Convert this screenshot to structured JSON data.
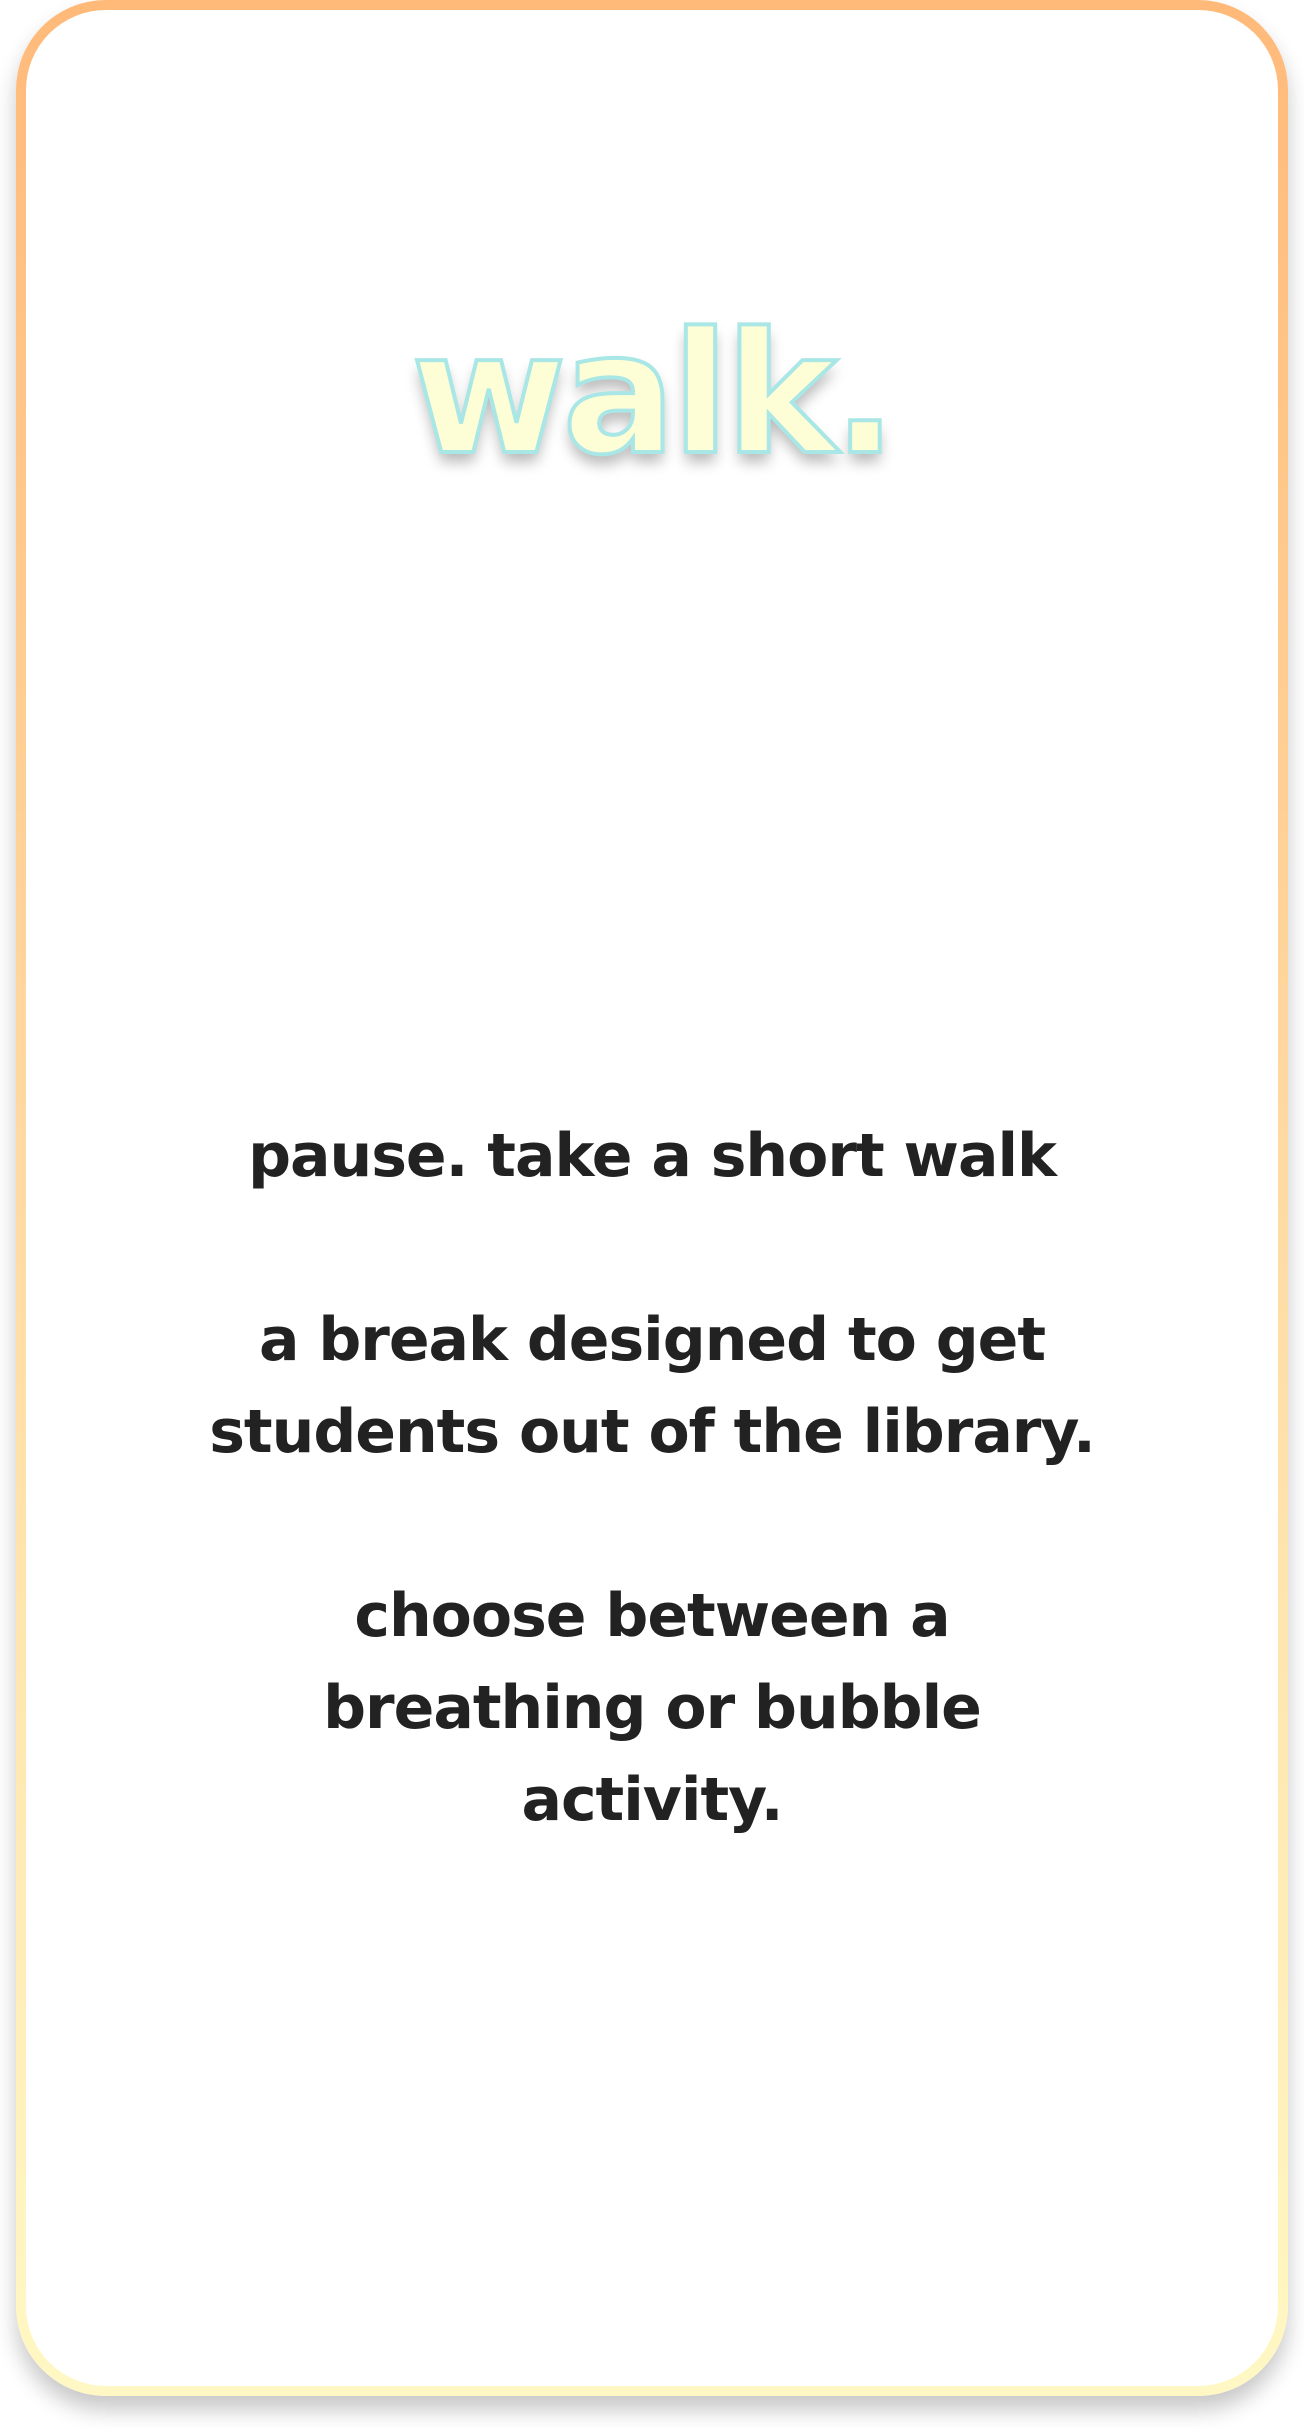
{
  "card": {
    "logo_text": "walk.",
    "tagline": "pause. take a short walk",
    "description": "a break designed to get\nstudents out of the library.",
    "instruction": "choose between a\nbreathing or bubble\nactivity."
  },
  "colors": {
    "border_top": "#ffba7a",
    "border_bottom": "#fff8c4",
    "logo_fill": "#fdfdd6",
    "logo_outline": "#a9e6e6",
    "text": "#222222",
    "background": "#ffffff"
  }
}
